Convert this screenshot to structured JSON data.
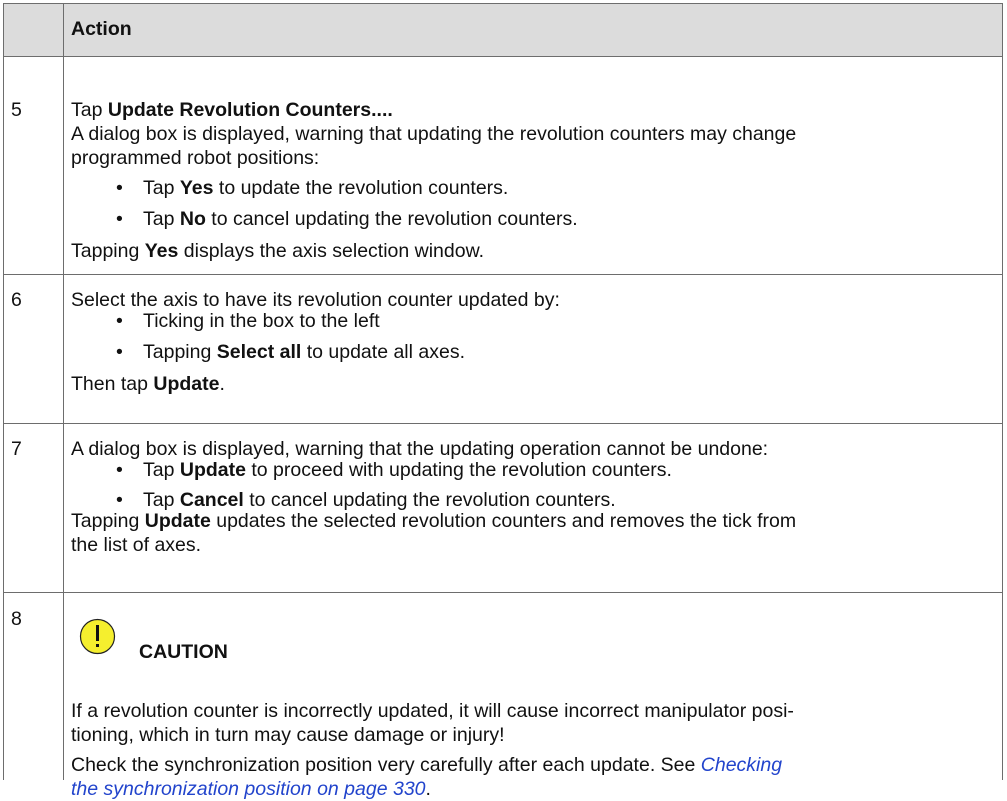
{
  "header": {
    "action": "Action"
  },
  "steps": [
    {
      "number": "5",
      "intro_pre": "Tap ",
      "intro_bold": "Update Revolution Counters...",
      "intro_post": ".",
      "desc_line1": "A dialog box is displayed, warning that updating the revolution counters may change",
      "desc_line2": "programmed robot positions:",
      "bullets": [
        {
          "pre": "Tap ",
          "bold": "Yes",
          "post": " to update the revolution counters."
        },
        {
          "pre": "Tap ",
          "bold": "No",
          "post": " to cancel updating the revolution counters."
        }
      ],
      "outro_pre": "Tapping ",
      "outro_bold": "Yes",
      "outro_post": " displays the axis selection window."
    },
    {
      "number": "6",
      "intro": "Select the axis to have its revolution counter updated by:",
      "bullets": [
        {
          "pre": "Ticking in the box to the left",
          "bold": "",
          "post": ""
        },
        {
          "pre": "Tapping ",
          "bold": "Select all",
          "post": " to update all axes."
        }
      ],
      "outro_pre": "Then tap ",
      "outro_bold": "Update",
      "outro_post": "."
    },
    {
      "number": "7",
      "intro": "A dialog box is displayed, warning that the updating operation cannot be undone:",
      "bullets": [
        {
          "pre": "Tap ",
          "bold": "Update",
          "post": " to proceed with updating the revolution counters."
        },
        {
          "pre": "Tap ",
          "bold": "Cancel",
          "post": " to cancel updating the revolution counters."
        }
      ],
      "outro_pre": "Tapping ",
      "outro_bold": "Update",
      "outro_post": " updates the selected revolution counters and removes the tick from",
      "outro_line2": "the list of axes."
    },
    {
      "number": "8",
      "caution_title": "CAUTION",
      "warn_line1": "If a revolution counter is incorrectly updated, it will cause incorrect manipulator posi-",
      "warn_line2": "tioning, which in turn may cause damage or injury!",
      "check_pre": "Check the synchronization position very carefully after each update. See ",
      "link_line1": "Checking",
      "link_line2": "the synchronization position on page 330",
      "check_post": "."
    }
  ],
  "colors": {
    "header_bg": "#dcdcdc",
    "link": "#2244cc",
    "caution_fill": "#f5ef2e"
  },
  "bullet_char": "•"
}
